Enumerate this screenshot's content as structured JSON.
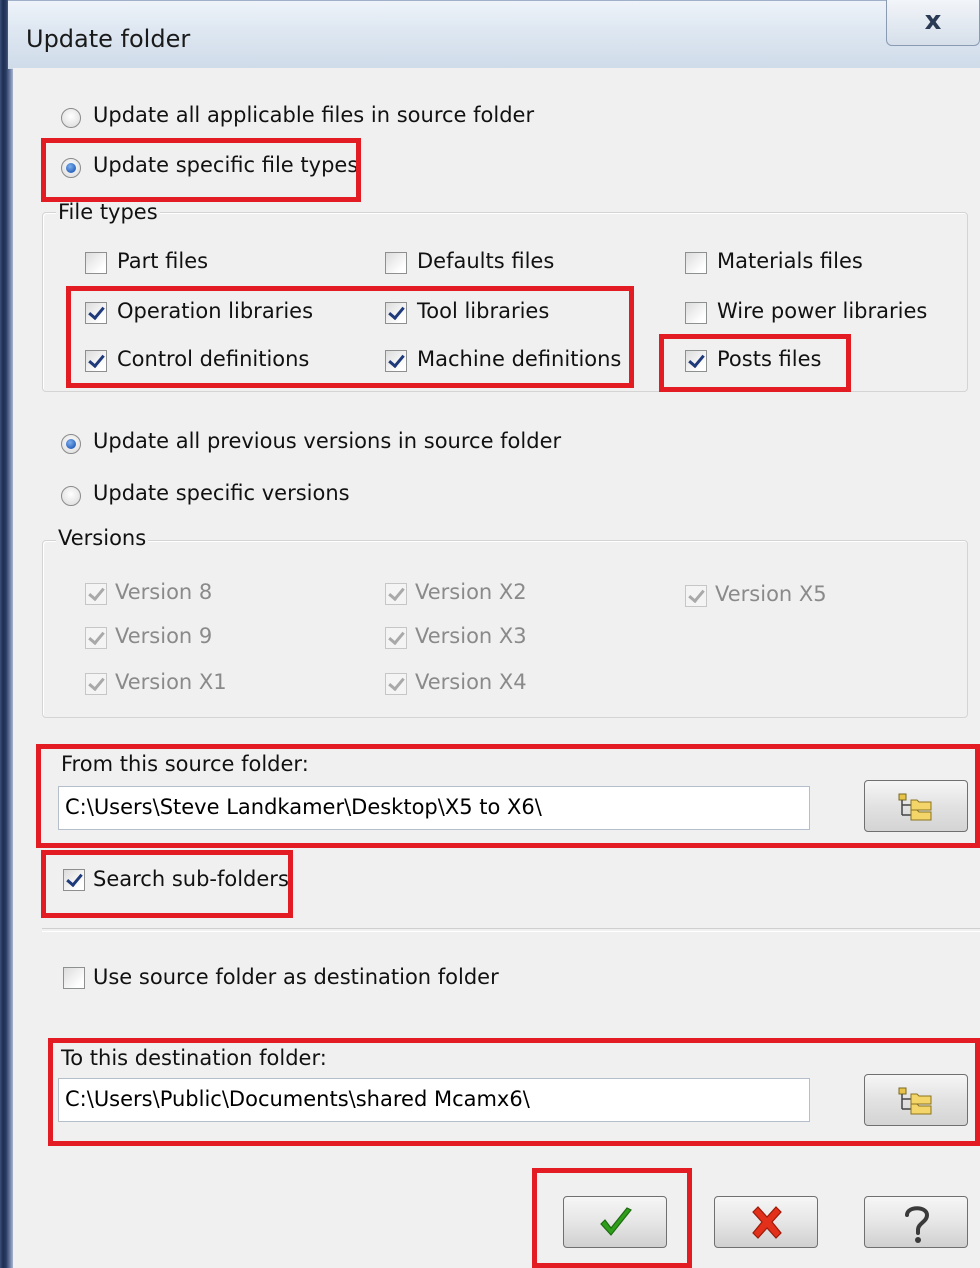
{
  "window": {
    "title": "Update folder",
    "close_glyph": "x"
  },
  "file_scope": {
    "all_label": "Update all applicable files in source folder",
    "specific_label": "Update specific file types",
    "selected": "specific"
  },
  "file_types": {
    "group_label": "File types",
    "items": [
      {
        "label": "Part files",
        "checked": false
      },
      {
        "label": "Defaults files",
        "checked": false
      },
      {
        "label": "Materials files",
        "checked": false
      },
      {
        "label": "Operation libraries",
        "checked": true
      },
      {
        "label": "Tool libraries",
        "checked": true
      },
      {
        "label": "Wire power libraries",
        "checked": false
      },
      {
        "label": "Control definitions",
        "checked": true
      },
      {
        "label": "Machine definitions",
        "checked": true
      },
      {
        "label": "Posts files",
        "checked": true
      }
    ]
  },
  "version_scope": {
    "all_label": "Update all previous versions in source folder",
    "specific_label": "Update specific versions",
    "selected": "all"
  },
  "versions": {
    "group_label": "Versions",
    "enabled": false,
    "items": [
      {
        "label": "Version 8",
        "checked": true
      },
      {
        "label": "Version X2",
        "checked": true
      },
      {
        "label": "Version X5",
        "checked": true
      },
      {
        "label": "Version 9",
        "checked": true
      },
      {
        "label": "Version X3",
        "checked": true
      },
      {
        "label": "Version X1",
        "checked": true
      },
      {
        "label": "Version X4",
        "checked": true
      }
    ]
  },
  "source": {
    "label": "From this source folder:",
    "value": "C:\\Users\\Steve Landkamer\\Desktop\\X5 to X6\\",
    "browse_icon": "folder-tree-icon"
  },
  "search_subfolders": {
    "label": "Search sub-folders",
    "checked": true
  },
  "use_source_as_dest": {
    "label": "Use source folder as destination folder",
    "checked": false
  },
  "destination": {
    "label": "To this destination folder:",
    "value": "C:\\Users\\Public\\Documents\\shared Mcamx6\\",
    "browse_icon": "folder-tree-icon"
  },
  "buttons": {
    "ok_icon": "green-checkmark-icon",
    "cancel_icon": "red-x-icon",
    "help_icon": "question-mark-icon"
  },
  "colors": {
    "highlight": "#e31b23",
    "ok": "#2f9e1a",
    "cancel": "#e2301a",
    "dialog_bg": "#f0f0f0"
  }
}
